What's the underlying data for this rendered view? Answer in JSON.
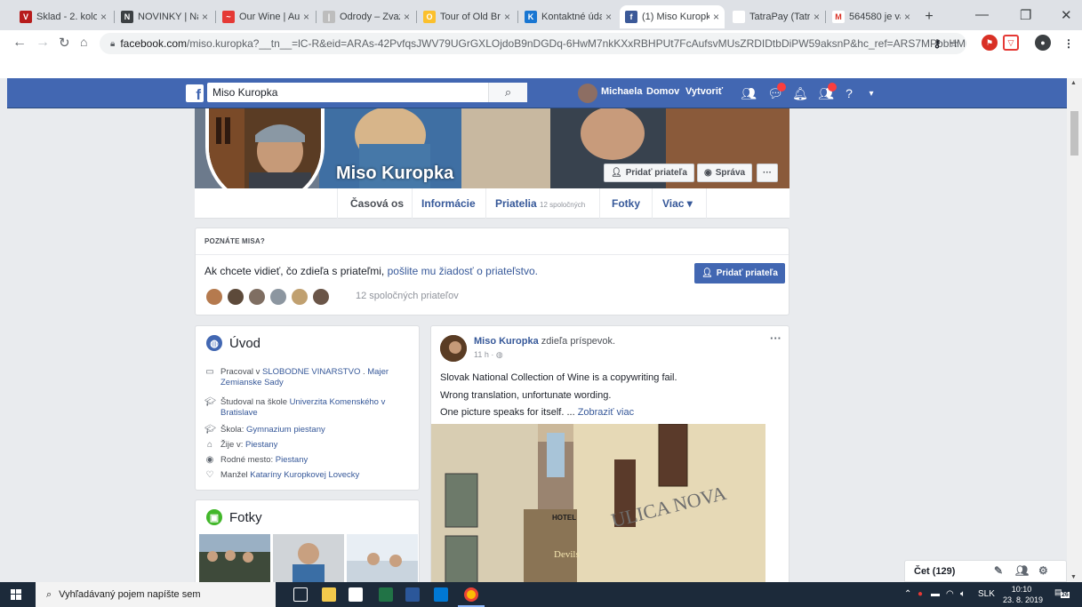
{
  "browser": {
    "tabs": [
      {
        "title": "Sklad - 2. kolo",
        "color": "#b71c1c",
        "glyph": "V",
        "active": false
      },
      {
        "title": "NOVINKY | Na",
        "color": "#3c4043",
        "glyph": "N",
        "active": false
      },
      {
        "title": "Our Wine | Au",
        "color": "#e53935",
        "glyph": "~",
        "active": false
      },
      {
        "title": "Odrody – Zvaz",
        "color": "#bdbdbd",
        "glyph": "|",
        "active": false
      },
      {
        "title": "Tour of Old Bra",
        "color": "#fbc02d",
        "glyph": "O",
        "active": false
      },
      {
        "title": "Kontaktné údaje",
        "color": "#1976d2",
        "glyph": "K",
        "active": false
      },
      {
        "title": "(1) Miso Kuropk",
        "color": "#3b5998",
        "glyph": "f",
        "active": true
      },
      {
        "title": "TatraPay (Tatra",
        "color": "#ffffff",
        "glyph": "",
        "active": false
      },
      {
        "title": "564580 je váš",
        "color": "#ffffff",
        "glyph": "M",
        "active": false
      }
    ],
    "new_tab": "+",
    "url_host": "facebook.com",
    "url_rest": "/miso.kuropka?__tn__=lC-R&eid=ARAs-42PvfqsJWV79UGrGXLOjdoB9nDGDq-6HwM7nkKXxRBHPUt7FcAufsvMUsZRDIDtbDiPW59aksnP&hc_ref=ARS7MPbbHMhL2eaaq..."
  },
  "fb": {
    "search_value": "Miso Kuropka",
    "user_name": "Michaela",
    "home": "Domov",
    "create": "Vytvoriť"
  },
  "profile": {
    "name": "Miso Kuropka",
    "add_friend": "Pridať priateľa",
    "message": "Správa",
    "more": "···",
    "tabs": {
      "timeline": "Časová os",
      "about": "Informácie",
      "friends": "Priatelia",
      "friends_sub": "12 spoločných",
      "photos": "Fotky",
      "more": "Viac ▾"
    }
  },
  "know": {
    "header": "POZNÁTE MISA?",
    "msg_pre": "Ak chcete vidieť, čo zdieľa s priateľmi,",
    "msg_link": "pošlite mu žiadosť o priateľstvo.",
    "button": "Pridať priateľa",
    "mutual": "12 spoločných priateľov"
  },
  "intro": {
    "title": "Úvod",
    "work_pre": "Pracoval v",
    "work_link": "SLOBODNE VINARSTVO",
    "work_sep": ".",
    "work_link2": "Majer Zemianske Sady",
    "study_pre": "Študoval na škole",
    "study_link": "Univerzita Komenského v Bratislave",
    "school_pre": "Škola:",
    "school_link": "Gymnazium piestany",
    "lives_pre": "Žije v:",
    "lives_link": "Piestany",
    "hometown_pre": "Rodné mesto:",
    "hometown_link": "Piestany",
    "spouse_pre": "Manžel",
    "spouse_link": "Kataríny Kuropkovej Lovecky"
  },
  "photos": {
    "title": "Fotky"
  },
  "post": {
    "author": "Miso Kuropka",
    "action": "zdieľa príspevok.",
    "time": "11 h ·",
    "line1": "Slovak National Collection of Wine is a copywriting fail.",
    "line2": "Wrong translation, unfortunate wording.",
    "line3": "One picture speaks for itself. ...",
    "more_link": "Zobraziť viac",
    "img_hotel": "HOTEL",
    "img_devils": "Devils",
    "img_sign": "ULICA NOVA"
  },
  "chat": {
    "label": "Čet (129)"
  },
  "taskbar": {
    "search_placeholder": "Vyhľadávaný pojem napíšte sem",
    "lang": "SLK",
    "time": "10:10",
    "date": "23. 8. 2019",
    "notif_count": "26"
  },
  "colors": {
    "fb_blue": "#4267b2",
    "link": "#365899"
  }
}
